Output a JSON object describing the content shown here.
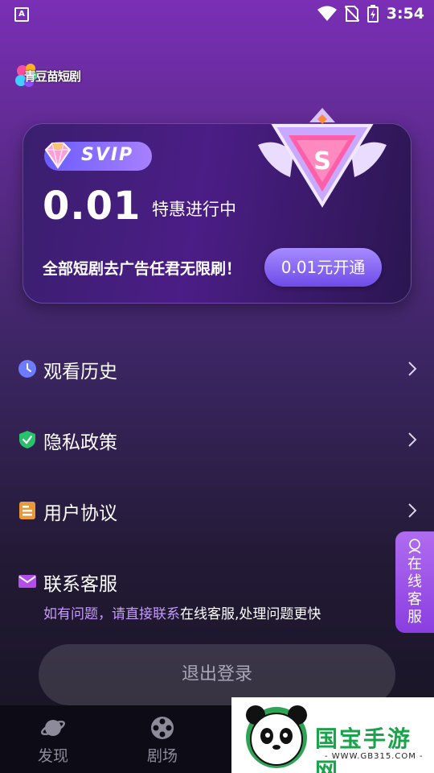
{
  "status_bar": {
    "time": "3:54",
    "app_icon_letter": "A"
  },
  "app": {
    "logo_text": "青豆苗短剧"
  },
  "vip_card": {
    "badge": "SVIP",
    "price": "0.01",
    "promo": "特惠进行中",
    "description": "全部短剧去广告任君无限刷！",
    "button": "0.01元开通",
    "emblem_letter": "S"
  },
  "menu": {
    "items": [
      {
        "label": "观看历史",
        "icon": "clock-icon"
      },
      {
        "label": "隐私政策",
        "icon": "shield-icon"
      },
      {
        "label": "用户协议",
        "icon": "document-icon"
      },
      {
        "label": "联系客服",
        "icon": "mail-icon"
      }
    ],
    "help_text_a": "如有问题，请直接联系",
    "help_text_b": "在线客服,处理问题更快"
  },
  "service_tab": {
    "label": "在线客服"
  },
  "logout": {
    "label": "退出登录"
  },
  "bottom_nav": {
    "items": [
      {
        "label": "发现",
        "icon": "planet-icon"
      },
      {
        "label": "剧场",
        "icon": "film-reel-icon"
      }
    ]
  },
  "watermark": {
    "title": "国宝手游网",
    "url": "- WWW.GB315.COM -"
  },
  "colors": {
    "accent": "#8a3ee0",
    "help_link": "#c79bff",
    "shield_green": "#27c26a",
    "doc_orange": "#e89a3a"
  }
}
